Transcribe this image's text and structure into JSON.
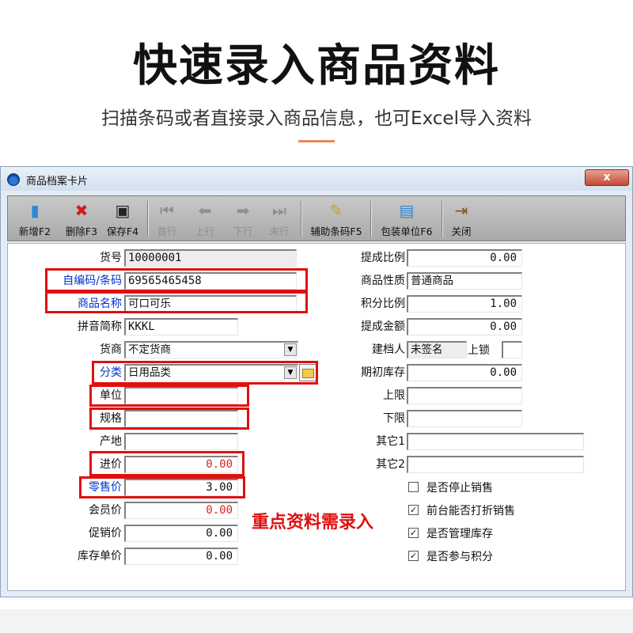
{
  "hero": {
    "title": "快速录入商品资料",
    "subtitle": "扫描条码或者直接录入商品信息，也可Excel导入资料"
  },
  "window": {
    "title": "商品档案卡片",
    "close_label": "x"
  },
  "toolbar": {
    "new": "新增F2",
    "delete": "删除F3",
    "save": "保存F4",
    "first": "首行",
    "prev": "上行",
    "next": "下行",
    "last": "末行",
    "barcode_helper": "辅助条码F5",
    "package_unit": "包装单位F6",
    "close": "关闭"
  },
  "left_fields": {
    "item_no": {
      "label": "货号",
      "value": "10000001"
    },
    "barcode": {
      "label": "自编码/条码",
      "value": "69565465458"
    },
    "name": {
      "label": "商品名称",
      "value": "可口可乐"
    },
    "pinyin": {
      "label": "拼音简称",
      "value": "KKKL"
    },
    "supplier": {
      "label": "货商",
      "value": "不定货商"
    },
    "category": {
      "label": "分类",
      "value": "日用品类"
    },
    "unit": {
      "label": "单位",
      "value": ""
    },
    "spec": {
      "label": "规格",
      "value": ""
    },
    "origin": {
      "label": "产地",
      "value": ""
    },
    "purchase_price": {
      "label": "进价",
      "value": "0.00"
    },
    "retail_price": {
      "label": "零售价",
      "value": "3.00"
    },
    "member_price": {
      "label": "会员价",
      "value": "0.00"
    },
    "promo_price": {
      "label": "促销价",
      "value": "0.00"
    },
    "stock_unit_price": {
      "label": "库存单价",
      "value": "0.00"
    }
  },
  "right_fields": {
    "commission_ratio": {
      "label": "提成比例",
      "value": "0.00"
    },
    "nature": {
      "label": "商品性质",
      "value": "普通商品"
    },
    "points_ratio": {
      "label": "积分比例",
      "value": "1.00"
    },
    "commission_amount": {
      "label": "提成金额",
      "value": "0.00"
    },
    "creator": {
      "label": "建档人",
      "value": "未签名"
    },
    "lock": {
      "label": "上锁"
    },
    "opening_stock": {
      "label": "期初库存",
      "value": "0.00"
    },
    "upper_limit": {
      "label": "上限",
      "value": ""
    },
    "lower_limit": {
      "label": "下限",
      "value": ""
    },
    "other1": {
      "label": "其它1",
      "value": ""
    },
    "other2": {
      "label": "其它2",
      "value": ""
    }
  },
  "checkboxes": [
    {
      "label": "是否停止销售",
      "checked": false,
      "mark": ""
    },
    {
      "label": "前台能否打折销售",
      "checked": true,
      "mark": "✓"
    },
    {
      "label": "是否管理库存",
      "checked": true,
      "mark": "✓"
    },
    {
      "label": "是否参与积分",
      "checked": true,
      "mark": "✓"
    }
  ],
  "annotation": "重点资料需录入",
  "colors": {
    "highlight_red": "#e01010",
    "label_blue": "#0033cc",
    "accent_line": "#e58a5a"
  }
}
